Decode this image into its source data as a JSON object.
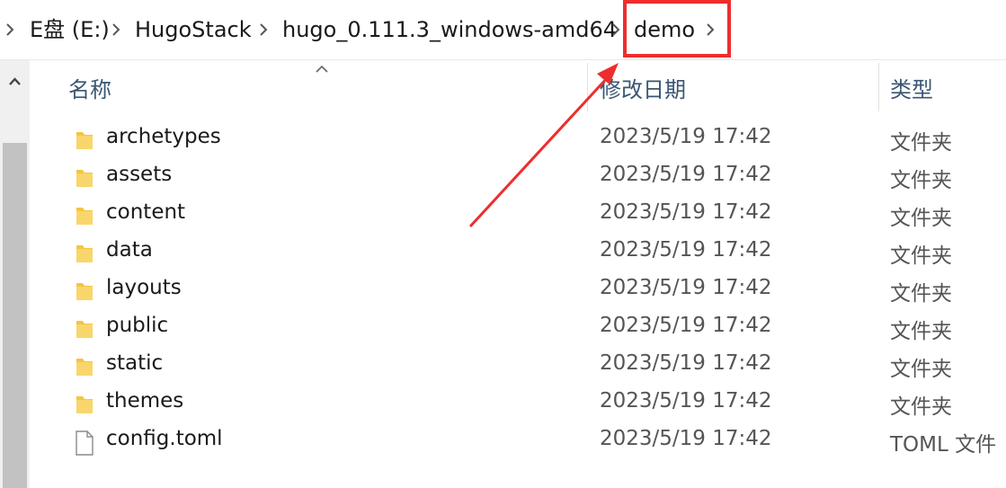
{
  "breadcrumb": {
    "items": [
      {
        "label": "E盘 (E:)"
      },
      {
        "label": "HugoStack"
      },
      {
        "label": "hugo_0.111.3_windows-amd64"
      },
      {
        "label": "demo"
      }
    ]
  },
  "columns": {
    "name": "名称",
    "date": "修改日期",
    "type": "类型"
  },
  "files": [
    {
      "name": "archetypes",
      "date": "2023/5/19 17:42",
      "type": "文件夹",
      "icon": "folder-icon"
    },
    {
      "name": "assets",
      "date": "2023/5/19 17:42",
      "type": "文件夹",
      "icon": "folder-icon"
    },
    {
      "name": "content",
      "date": "2023/5/19 17:42",
      "type": "文件夹",
      "icon": "folder-icon"
    },
    {
      "name": "data",
      "date": "2023/5/19 17:42",
      "type": "文件夹",
      "icon": "folder-icon"
    },
    {
      "name": "layouts",
      "date": "2023/5/19 17:42",
      "type": "文件夹",
      "icon": "folder-icon"
    },
    {
      "name": "public",
      "date": "2023/5/19 17:42",
      "type": "文件夹",
      "icon": "folder-icon"
    },
    {
      "name": "static",
      "date": "2023/5/19 17:42",
      "type": "文件夹",
      "icon": "folder-icon"
    },
    {
      "name": "themes",
      "date": "2023/5/19 17:42",
      "type": "文件夹",
      "icon": "folder-icon"
    },
    {
      "name": "config.toml",
      "date": "2023/5/19 17:42",
      "type": "TOML 文件",
      "icon": "file-icon"
    }
  ],
  "colors": {
    "annotation": "#ee2d2d",
    "folder": "#f5c542",
    "header_text": "#3a5673"
  }
}
